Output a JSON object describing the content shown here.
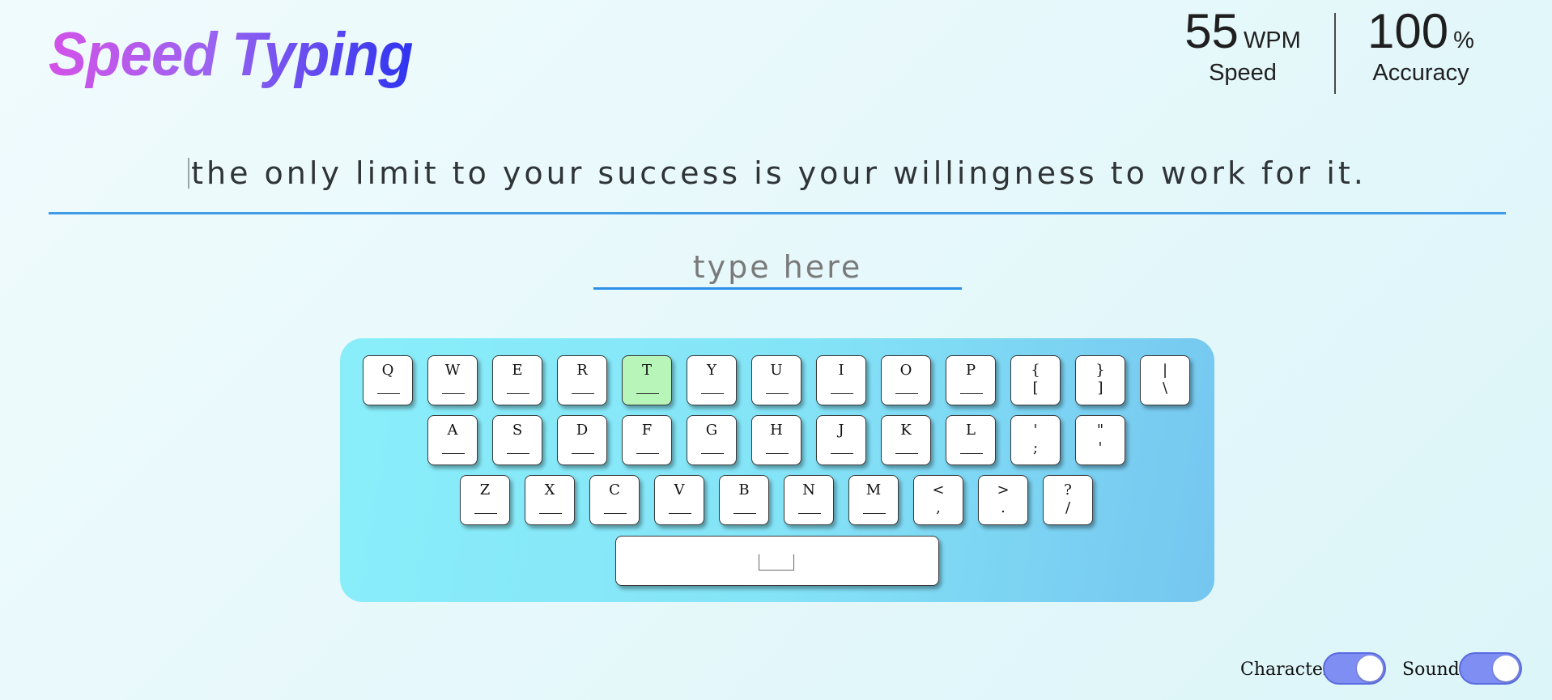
{
  "app": {
    "title": "Speed Typing"
  },
  "stats": {
    "speed": {
      "value": "55",
      "unit": "WPM",
      "label": "Speed"
    },
    "accuracy": {
      "value": "100",
      "unit": "%",
      "label": "Accuracy"
    }
  },
  "quote": {
    "text": "the only limit to your success is your willingness to work for it."
  },
  "input": {
    "placeholder": "type here",
    "value": ""
  },
  "keyboard": {
    "active_key": "T",
    "rows": [
      [
        {
          "top": "Q",
          "bottom": ""
        },
        {
          "top": "W",
          "bottom": ""
        },
        {
          "top": "E",
          "bottom": ""
        },
        {
          "top": "R",
          "bottom": ""
        },
        {
          "top": "T",
          "bottom": ""
        },
        {
          "top": "Y",
          "bottom": ""
        },
        {
          "top": "U",
          "bottom": ""
        },
        {
          "top": "I",
          "bottom": ""
        },
        {
          "top": "O",
          "bottom": ""
        },
        {
          "top": "P",
          "bottom": ""
        },
        {
          "top": "{",
          "bottom": "["
        },
        {
          "top": "}",
          "bottom": "]"
        },
        {
          "top": "|",
          "bottom": "\\"
        }
      ],
      [
        {
          "top": "A",
          "bottom": ""
        },
        {
          "top": "S",
          "bottom": ""
        },
        {
          "top": "D",
          "bottom": ""
        },
        {
          "top": "F",
          "bottom": ""
        },
        {
          "top": "G",
          "bottom": ""
        },
        {
          "top": "H",
          "bottom": ""
        },
        {
          "top": "J",
          "bottom": ""
        },
        {
          "top": "K",
          "bottom": ""
        },
        {
          "top": "L",
          "bottom": ""
        },
        {
          "top": "'",
          "bottom": ";"
        },
        {
          "top": "\"",
          "bottom": "'"
        }
      ],
      [
        {
          "top": "Z",
          "bottom": ""
        },
        {
          "top": "X",
          "bottom": ""
        },
        {
          "top": "C",
          "bottom": ""
        },
        {
          "top": "V",
          "bottom": ""
        },
        {
          "top": "B",
          "bottom": ""
        },
        {
          "top": "N",
          "bottom": ""
        },
        {
          "top": "M",
          "bottom": ""
        },
        {
          "top": "<",
          "bottom": ","
        },
        {
          "top": ">",
          "bottom": "."
        },
        {
          "top": "?",
          "bottom": "/"
        }
      ]
    ]
  },
  "toggles": {
    "character": {
      "label": "Character",
      "on": true
    },
    "sound": {
      "label": "Sound",
      "on": true
    }
  },
  "colors": {
    "accent_line": "#3f9be6",
    "active_key": "#b7f5b9",
    "toggle_on": "#7e8ef2"
  }
}
